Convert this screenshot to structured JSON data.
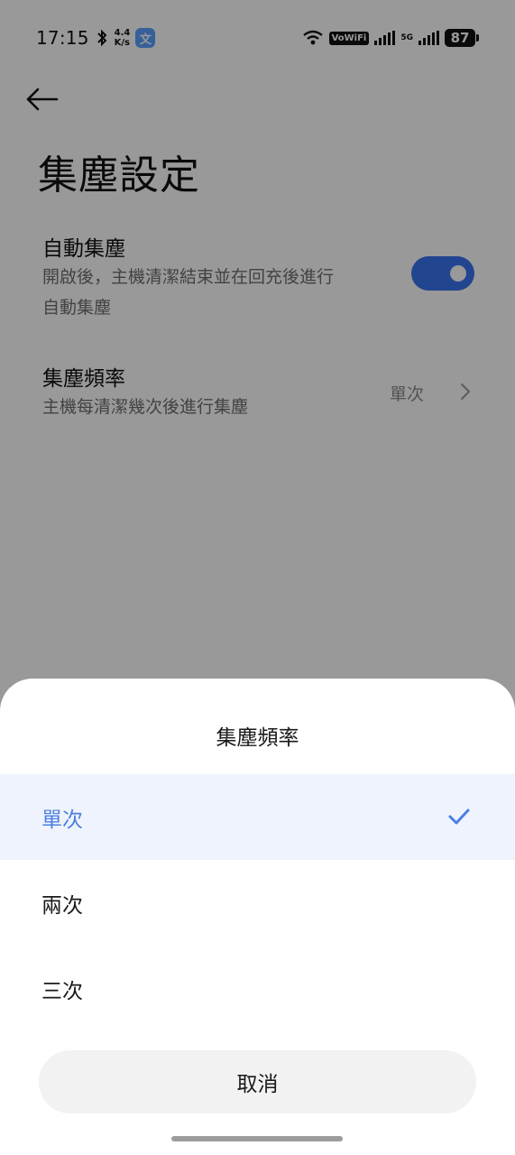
{
  "status_bar": {
    "time": "17:15",
    "speed_value": "4.4",
    "speed_unit": "K/s",
    "app_icon_glyph": "文",
    "wifi_label": "VoWiFi",
    "network_label": "5G",
    "battery": "87"
  },
  "page": {
    "title": "集塵設定",
    "auto_collect": {
      "title": "自動集塵",
      "desc_line1": "開啟後，主機清潔結束並在回充後進行",
      "desc_line2": "自動集塵",
      "enabled": true
    },
    "frequency": {
      "title": "集塵頻率",
      "desc": "主機每清潔幾次後進行集塵",
      "value": "單次"
    }
  },
  "sheet": {
    "title": "集塵頻率",
    "options": [
      {
        "label": "單次",
        "selected": true
      },
      {
        "label": "兩次",
        "selected": false
      },
      {
        "label": "三次",
        "selected": false
      }
    ],
    "cancel_label": "取消"
  },
  "colors": {
    "accent": "#3a73f0",
    "selected_text": "#4d7fe0",
    "selected_bg": "#eef3fd"
  }
}
